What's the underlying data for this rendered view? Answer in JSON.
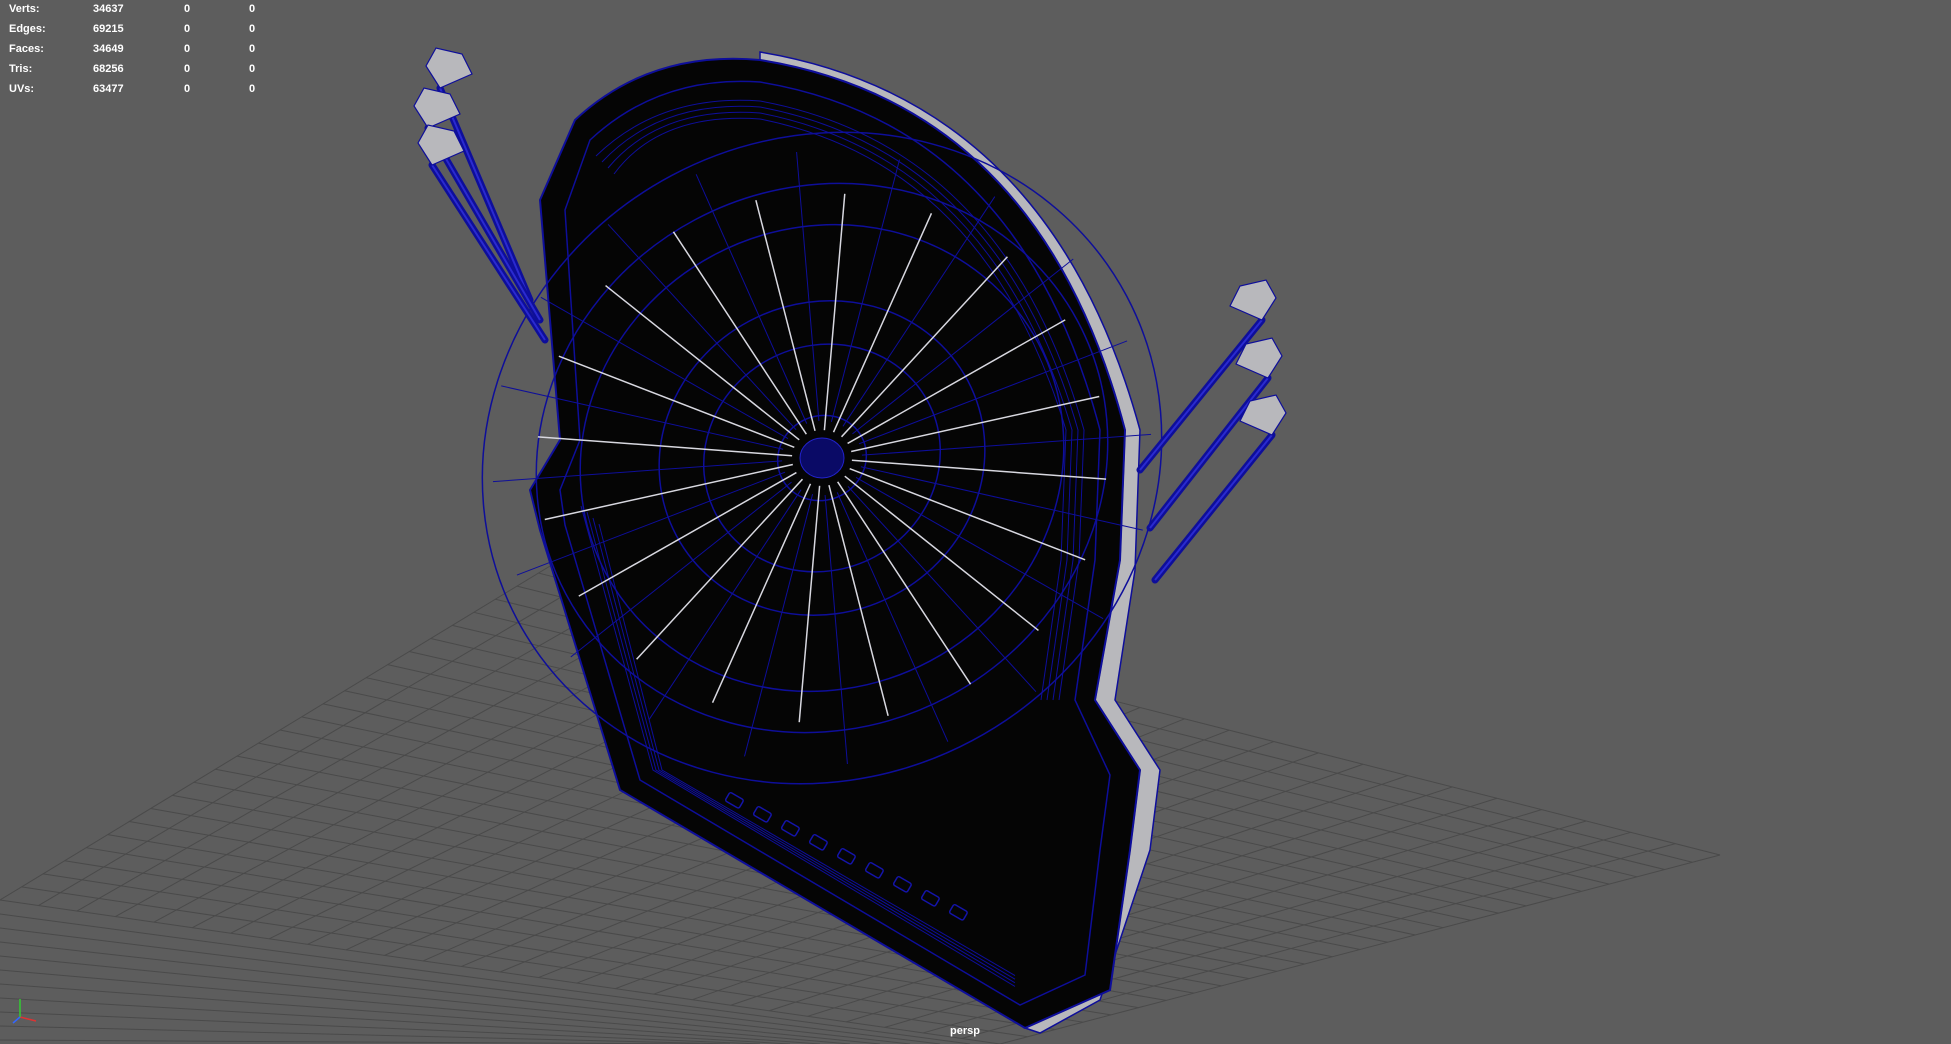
{
  "hud": {
    "rows": [
      {
        "label": "Verts:",
        "values": [
          "34637",
          "0",
          "0"
        ]
      },
      {
        "label": "Edges:",
        "values": [
          "69215",
          "0",
          "0"
        ]
      },
      {
        "label": "Faces:",
        "values": [
          "34649",
          "0",
          "0"
        ]
      },
      {
        "label": "Tris:",
        "values": [
          "68256",
          "0",
          "0"
        ]
      },
      {
        "label": "UVs:",
        "values": [
          "63477",
          "0",
          "0"
        ]
      }
    ]
  },
  "camera_label": "persp",
  "colors": {
    "background": "#5d5d5d",
    "grid": "#4a4a4a",
    "wire": "#0e0e9a",
    "shaded": "#b8b8bc",
    "hud_text": "#ffffff"
  },
  "icons": {
    "axis_gizmo": "xyz-axis-icon"
  }
}
